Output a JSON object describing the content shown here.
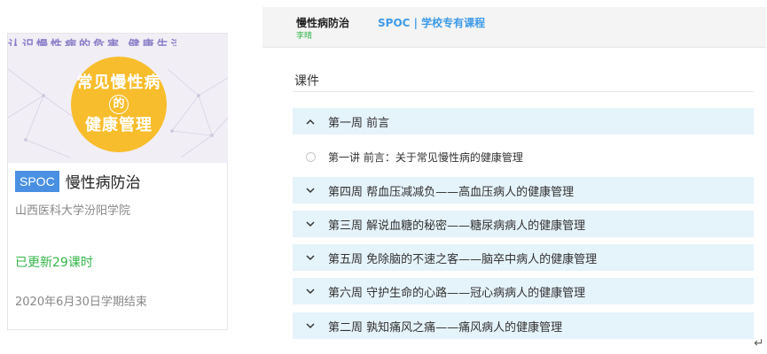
{
  "course_card": {
    "banner_text": "认识慢性病的危害 健康生活",
    "cover_line1": "常见慢性病",
    "cover_line2": "的",
    "cover_line3": "健康管理",
    "badge": "SPOC",
    "title": "慢性病防治",
    "school": "山西医科大学汾阳学院",
    "updated": "已更新29课时",
    "term_end": "2020年6月30日学期结束"
  },
  "header": {
    "course_name": "慢性病防治",
    "teacher": "李晴",
    "spoc_title": "SPOC | 学校专有课程"
  },
  "courseware": {
    "title": "课件",
    "weeks": [
      {
        "label": "第一周 前言",
        "expanded": true
      },
      {
        "label": "第四周 帮血压减减负——高血压病人的健康管理",
        "expanded": false
      },
      {
        "label": "第三周 解说血糖的秘密——糖尿病病人的健康管理",
        "expanded": false
      },
      {
        "label": "第五周 免除脑的不速之客——脑卒中病人的健康管理",
        "expanded": false
      },
      {
        "label": "第六周 守护生命的心路——冠心病病人的健康管理",
        "expanded": false
      },
      {
        "label": "第二周 孰知痛风之痛——痛风病人的健康管理",
        "expanded": false
      }
    ],
    "lessons": [
      {
        "label": "第一讲 前言：关于常见慢性病的健康管理"
      }
    ]
  },
  "colors": {
    "accent_blue": "#4a90e2",
    "spoc_text_blue": "#3d9be9",
    "green": "#34b64a",
    "week_bg": "#e5f3fb",
    "cover_circle": "#f8bd2c",
    "cover_bg": "#f1eef6"
  },
  "icons": {
    "expanded": "chevron-up-icon",
    "collapsed": "chevron-down-icon",
    "lesson": "circle-icon",
    "return": "return-arrow-icon"
  },
  "return_mark": "↵"
}
